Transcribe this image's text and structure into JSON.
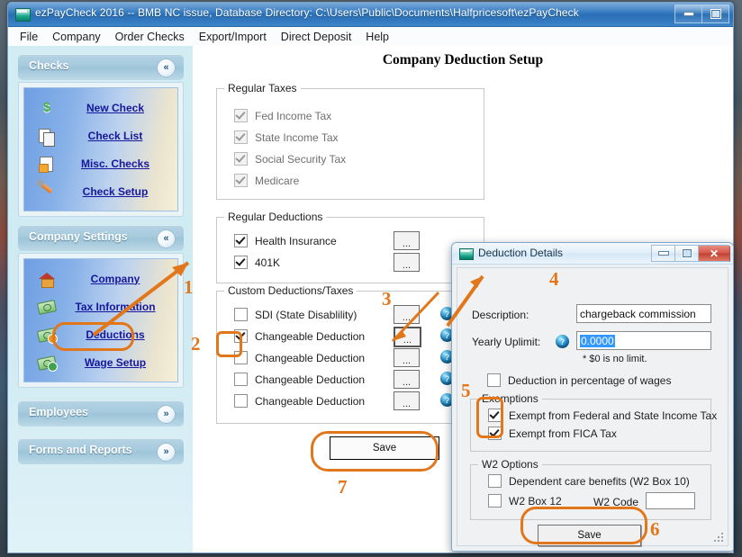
{
  "window": {
    "title": "ezPayCheck 2016 -- BMB NC issue, Database Directory: C:\\Users\\Public\\Documents\\Halfpricesoft\\ezPayCheck",
    "icon": "app-icon",
    "buttons": [
      {
        "name": "minimize",
        "glyph": "–"
      },
      {
        "name": "restore",
        "glyph": "❐"
      }
    ]
  },
  "menu": [
    "File",
    "Company",
    "Order Checks",
    "Export/Import",
    "Direct Deposit",
    "Help"
  ],
  "sidebar": {
    "groups": [
      {
        "title": "Checks",
        "expanded": true,
        "chevron": "«",
        "items": [
          {
            "label": "New Check",
            "icon": "dollar-icon"
          },
          {
            "label": "Check List",
            "icon": "pages-icon"
          },
          {
            "label": "Misc. Checks",
            "icon": "locked-document-icon"
          },
          {
            "label": "Check Setup",
            "icon": "wrench-icon"
          }
        ]
      },
      {
        "title": "Company Settings",
        "expanded": true,
        "chevron": "«",
        "items": [
          {
            "label": "Company",
            "icon": "house-icon"
          },
          {
            "label": "Tax Information",
            "icon": "money-icon"
          },
          {
            "label": "Deductions",
            "icon": "money-minus-icon"
          },
          {
            "label": "Wage Setup",
            "icon": "money-plus-icon"
          }
        ]
      },
      {
        "title": "Employees",
        "expanded": false,
        "chevron": "»",
        "items": []
      },
      {
        "title": "Forms and Reports",
        "expanded": false,
        "chevron": "»",
        "items": []
      }
    ]
  },
  "main": {
    "page_title": "Company Deduction Setup",
    "regular_taxes": {
      "legend": "Regular Taxes",
      "items": [
        {
          "label": "Fed Income Tax",
          "checked": true,
          "disabled": true
        },
        {
          "label": "State Income Tax",
          "checked": true,
          "disabled": true
        },
        {
          "label": "Social Security Tax",
          "checked": true,
          "disabled": true
        },
        {
          "label": "Medicare",
          "checked": true,
          "disabled": true
        }
      ]
    },
    "regular_deductions": {
      "legend": "Regular Deductions",
      "items": [
        {
          "label": "Health Insurance",
          "checked": true,
          "button": "...",
          "help": false
        },
        {
          "label": "401K",
          "checked": true,
          "button": "...",
          "help": false
        }
      ]
    },
    "custom_deductions": {
      "legend": "Custom Deductions/Taxes",
      "items": [
        {
          "label": "SDI (State Disablility)",
          "checked": false,
          "button": "...",
          "help": "?"
        },
        {
          "label": "Changeable Deduction",
          "checked": true,
          "button": "...",
          "help": "?"
        },
        {
          "label": "Changeable Deduction",
          "checked": false,
          "button": "...",
          "help": "?"
        },
        {
          "label": "Changeable Deduction",
          "checked": false,
          "button": "...",
          "help": "?"
        },
        {
          "label": "Changeable Deduction",
          "checked": false,
          "button": "...",
          "help": "?"
        }
      ]
    },
    "save_label": "Save"
  },
  "dialog": {
    "title": "Deduction Details",
    "buttons": [
      {
        "name": "minimize",
        "glyph": "–"
      },
      {
        "name": "restore",
        "glyph": "❐"
      },
      {
        "name": "close",
        "glyph": "✕"
      }
    ],
    "description_label": "Description:",
    "description_value": "chargeback commission",
    "description_placeholder": "",
    "uplimit_label": "Yearly Uplimit:",
    "uplimit_help": "?",
    "uplimit_value": "0.0000",
    "uplimit_hint": "* $0 is no limit.",
    "percentage_label": "Deduction in percentage of wages",
    "percentage_checked": false,
    "exemptions": {
      "legend": "Exemptions",
      "items": [
        {
          "label": "Exempt from Federal and State Income Tax",
          "checked": true
        },
        {
          "label": "Exempt from FICA Tax",
          "checked": true
        }
      ]
    },
    "w2_options": {
      "legend": "W2 Options",
      "items": [
        {
          "label": "Dependent care benefits (W2 Box 10)",
          "checked": false
        },
        {
          "label": "W2 Box 12",
          "checked": false
        }
      ],
      "code_label": "W2 Code",
      "code_value": ""
    },
    "save_label": "Save"
  },
  "annotations": {
    "accent_color": "#e2761b",
    "steps": [
      {
        "number": "1",
        "target": "sidebar-item-deductions"
      },
      {
        "number": "2",
        "target": "custom-deduction-row-2-checkbox"
      },
      {
        "number": "3",
        "target": "custom-deduction-row-2-dots-button"
      },
      {
        "number": "4",
        "target": "dialog-window"
      },
      {
        "number": "5",
        "target": "exemptions-checkboxes"
      },
      {
        "number": "6",
        "target": "dialog-save-button"
      },
      {
        "number": "7",
        "target": "main-save-button"
      }
    ]
  }
}
